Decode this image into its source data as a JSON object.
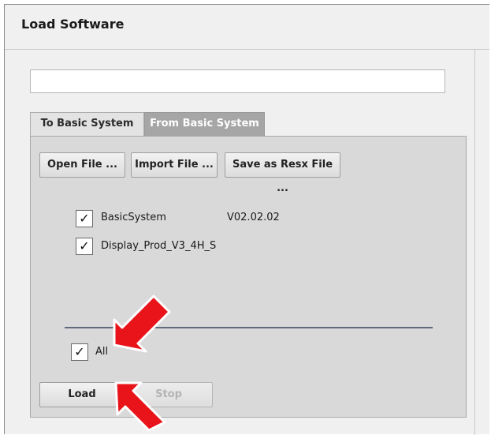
{
  "window": {
    "title": "Load Software"
  },
  "path_input": {
    "value": "",
    "placeholder": ""
  },
  "tabs": [
    {
      "label": "To Basic System",
      "active": false
    },
    {
      "label": "From Basic System",
      "active": true
    }
  ],
  "buttons": {
    "open_file": "Open File ...",
    "import_file": "Import File ...",
    "save_resx": "Save as Resx File ...",
    "load": "Load",
    "stop": "Stop"
  },
  "software_list": [
    {
      "name": "BasicSystem",
      "version": "V02.02.02",
      "checked": true
    },
    {
      "name": "Display_Prod_V3_4H_S",
      "version": "",
      "checked": true
    }
  ],
  "all_checkbox": {
    "label": "All",
    "checked": true
  },
  "checkmark_glyph": "✓",
  "annotations": {
    "arrow_color": "#e8141a",
    "arrow_count": 2
  }
}
